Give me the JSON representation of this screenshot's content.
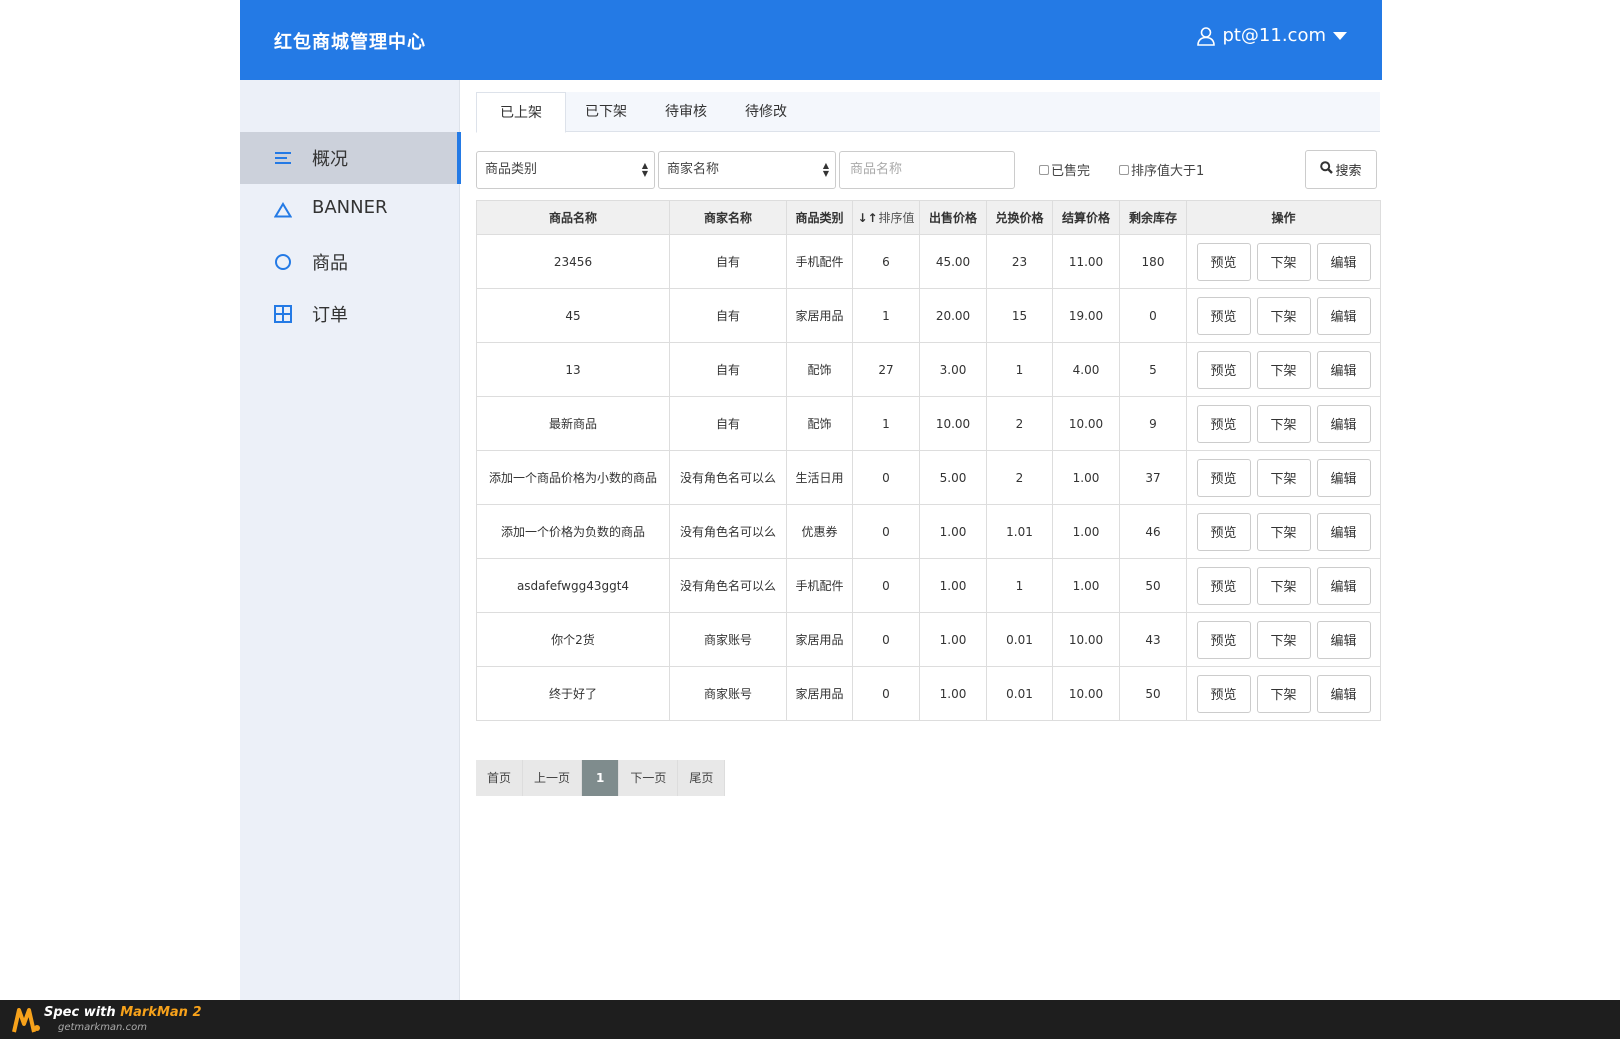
{
  "colors": {
    "primary": "#247ae5",
    "sidebar_bg": "#ecf0f8",
    "active_item_bg": "#ccd1db",
    "tabbar_bg": "#f4f7fc"
  },
  "header": {
    "title": "红包商城管理中心",
    "user_email": "pt@11.com"
  },
  "sidebar": {
    "items": [
      {
        "label": "概况",
        "icon": "list-icon",
        "active": true
      },
      {
        "label": "BANNER",
        "icon": "triangle-icon"
      },
      {
        "label": "商品",
        "icon": "circle-icon"
      },
      {
        "label": "订单",
        "icon": "grid-icon"
      }
    ]
  },
  "tabs": [
    "已上架",
    "已下架",
    "待审核",
    "待修改"
  ],
  "filters": {
    "category_select": "商品类别",
    "merchant_select": "商家名称",
    "product_name_placeholder": "商品名称",
    "sold_out_label": "已售完",
    "sort_gt1_label": "排序值大于1",
    "search_label": "搜索"
  },
  "table": {
    "columns": [
      "商品名称",
      "商家名称",
      "商品类别",
      "排序值",
      "出售价格",
      "兑换价格",
      "结算价格",
      "剩余库存",
      "操作"
    ],
    "action_labels": {
      "preview": "预览",
      "off_shelf": "下架",
      "edit": "编辑"
    },
    "rows": [
      [
        "23456",
        "自有",
        "手机配件",
        "6",
        "45.00",
        "23",
        "11.00",
        "180"
      ],
      [
        "45",
        "自有",
        "家居用品",
        "1",
        "20.00",
        "15",
        "19.00",
        "0"
      ],
      [
        "13",
        "自有",
        "配饰",
        "27",
        "3.00",
        "1",
        "4.00",
        "5"
      ],
      [
        "最新商品",
        "自有",
        "配饰",
        "1",
        "10.00",
        "2",
        "10.00",
        "9"
      ],
      [
        "添加一个商品价格为小数的商品",
        "没有角色名可以么",
        "生活日用",
        "0",
        "5.00",
        "2",
        "1.00",
        "37"
      ],
      [
        "添加一个价格为负数的商品",
        "没有角色名可以么",
        "优惠券",
        "0",
        "1.00",
        "1.01",
        "1.00",
        "46"
      ],
      [
        "asdafefwgg43ggt4",
        "没有角色名可以么",
        "手机配件",
        "0",
        "1.00",
        "1",
        "1.00",
        "50"
      ],
      [
        "你个2货",
        "商家账号",
        "家居用品",
        "0",
        "1.00",
        "0.01",
        "10.00",
        "43"
      ],
      [
        "终于好了",
        "商家账号",
        "家居用品",
        "0",
        "1.00",
        "0.01",
        "10.00",
        "50"
      ]
    ]
  },
  "pagination": {
    "first": "首页",
    "prev": "上一页",
    "current": "1",
    "next": "下一页",
    "last": "尾页"
  },
  "footer": {
    "prefix": "Spec with ",
    "brand": "MarkMan 2",
    "site": "getmarkman.com"
  }
}
